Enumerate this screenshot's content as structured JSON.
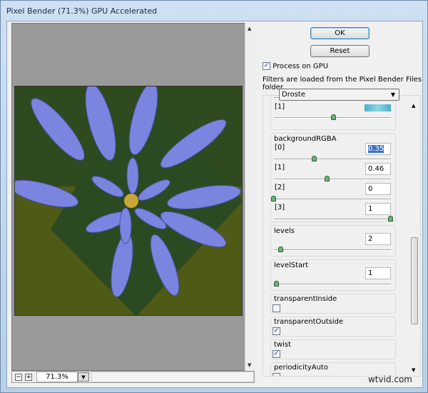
{
  "window": {
    "title": "Pixel Bender (71.3%) GPU Accelerated"
  },
  "canvas": {
    "zoom_value": "71.3%",
    "zoom_out": "−",
    "zoom_in": "+"
  },
  "buttons": {
    "ok": "OK",
    "reset": "Reset"
  },
  "process_on_gpu": {
    "label": "Process on GPU",
    "checked": true
  },
  "info_text": "Filters are loaded from the Pixel Bender Files folder.",
  "filter_select": {
    "value": "Droste"
  },
  "params": {
    "prev_index_label": "[1]",
    "backgroundRGBA": {
      "label": "backgroundRGBA",
      "items": [
        {
          "label": "[0]",
          "value": "0.35",
          "fraction": 0.35
        },
        {
          "label": "[1]",
          "value": "0.46",
          "fraction": 0.46
        },
        {
          "label": "[2]",
          "value": "0",
          "fraction": 0
        },
        {
          "label": "[3]",
          "value": "1",
          "fraction": 1
        }
      ]
    },
    "levels": {
      "label": "levels",
      "value": "2",
      "fraction": 0.06
    },
    "levelStart": {
      "label": "levelStart",
      "value": "1",
      "fraction": 0
    },
    "checkboxes": [
      {
        "label": "transparentInside",
        "checked": false
      },
      {
        "label": "transparentOutside",
        "checked": true
      },
      {
        "label": "twist",
        "checked": true
      },
      {
        "label": "periodicityAuto",
        "checked": false
      }
    ]
  },
  "watermark": "wtvid.com"
}
